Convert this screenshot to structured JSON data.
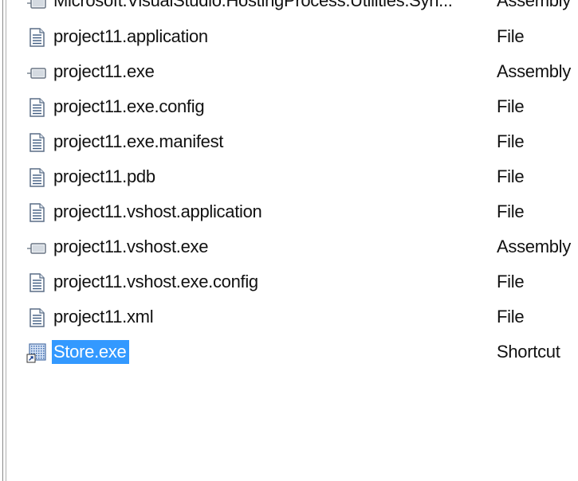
{
  "files": [
    {
      "name": "Microsoft.VisualStudio.HostingProcess.Utilities.Syn...",
      "type": "Assembly",
      "icon": "assembly-icon"
    },
    {
      "name": "project11.application",
      "type": "File",
      "icon": "file-icon"
    },
    {
      "name": "project11.exe",
      "type": "Assembly",
      "icon": "assembly-icon"
    },
    {
      "name": "project11.exe.config",
      "type": "File",
      "icon": "file-icon"
    },
    {
      "name": "project11.exe.manifest",
      "type": "File",
      "icon": "file-icon"
    },
    {
      "name": "project11.pdb",
      "type": "File",
      "icon": "file-icon"
    },
    {
      "name": "project11.vshost.application",
      "type": "File",
      "icon": "file-icon"
    },
    {
      "name": "project11.vshost.exe",
      "type": "Assembly",
      "icon": "assembly-icon"
    },
    {
      "name": "project11.vshost.exe.config",
      "type": "File",
      "icon": "file-icon"
    },
    {
      "name": "project11.xml",
      "type": "File",
      "icon": "file-icon"
    },
    {
      "name": "Store.exe",
      "type": "Shortcut",
      "icon": "shortcut-icon",
      "selected": true
    }
  ],
  "colors": {
    "selection": "#3399ff",
    "text": "#111111"
  }
}
